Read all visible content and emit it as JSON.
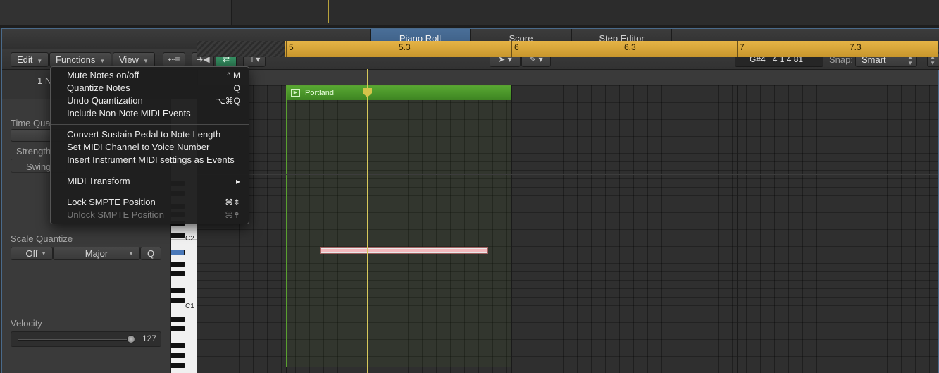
{
  "tabs": [
    "Piano Roll",
    "Score",
    "Step Editor"
  ],
  "toolbar": {
    "edit": "Edit",
    "functions": "Functions",
    "view": "View",
    "lcd_pitch": "G#4",
    "lcd_position": "4 1 4 81",
    "snap_label": "Snap:",
    "snap_value": "Smart"
  },
  "inspector": {
    "header": "1 N",
    "time_quantize": "Time Qua",
    "strength": "Strength",
    "swing": "Swing",
    "scale_quantize": "Scale Quantize",
    "scale_off": "Off",
    "scale_major": "Major",
    "scale_q": "Q",
    "velocity": "Velocity",
    "velocity_value": "127"
  },
  "keyboard": {
    "c2": "C2",
    "c1": "C1"
  },
  "ruler": [
    "5",
    "5.3",
    "6",
    "6.3",
    "7",
    "7.3"
  ],
  "region": {
    "name": "Portland"
  },
  "menu": {
    "items": [
      {
        "label": "Mute Notes on/off",
        "shortcut": "^ M"
      },
      {
        "label": "Quantize Notes",
        "shortcut": "Q"
      },
      {
        "label": "Undo Quantization",
        "shortcut": "⌥⌘Q"
      },
      {
        "label": "Include Non-Note MIDI Events",
        "shortcut": ""
      },
      {
        "label": "Convert Sustain Pedal to Note Length",
        "shortcut": ""
      },
      {
        "label": "Set MIDI Channel to Voice Number",
        "shortcut": ""
      },
      {
        "label": "Insert Instrument MIDI settings as Events",
        "shortcut": ""
      },
      {
        "label": "MIDI Transform",
        "shortcut": "▸"
      },
      {
        "label": "Lock SMPTE Position",
        "shortcut": "⌘⇟"
      },
      {
        "label": "Unlock SMPTE Position",
        "shortcut": "⌘⇞"
      }
    ]
  }
}
